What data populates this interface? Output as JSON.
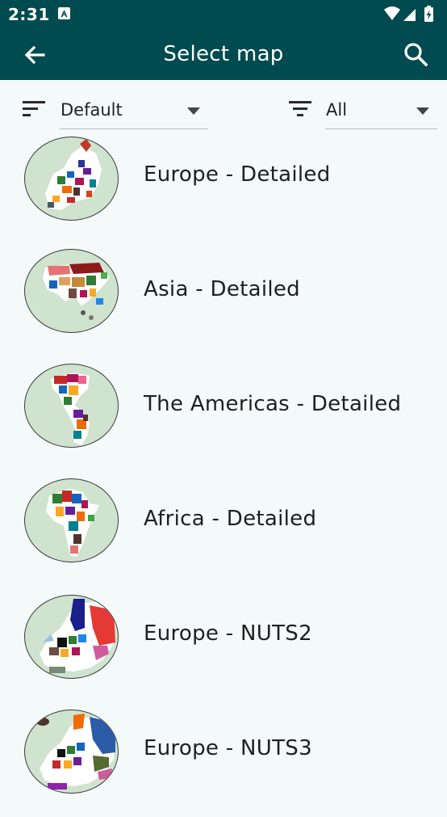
{
  "status": {
    "time": "2:31",
    "a_badge": "A"
  },
  "appbar": {
    "title": "Select map"
  },
  "filters": {
    "sort_value": "Default",
    "filter_value": "All"
  },
  "maps": [
    {
      "label": "Europe - Detailed"
    },
    {
      "label": "Asia - Detailed"
    },
    {
      "label": "The Americas - Detailed"
    },
    {
      "label": "Africa - Detailed"
    },
    {
      "label": "Europe - NUTS2"
    },
    {
      "label": "Europe - NUTS3"
    }
  ],
  "colors": {
    "primary": "#004b4f",
    "background": "#f4f9fa",
    "thumb_bg": "#cfe3cf"
  }
}
